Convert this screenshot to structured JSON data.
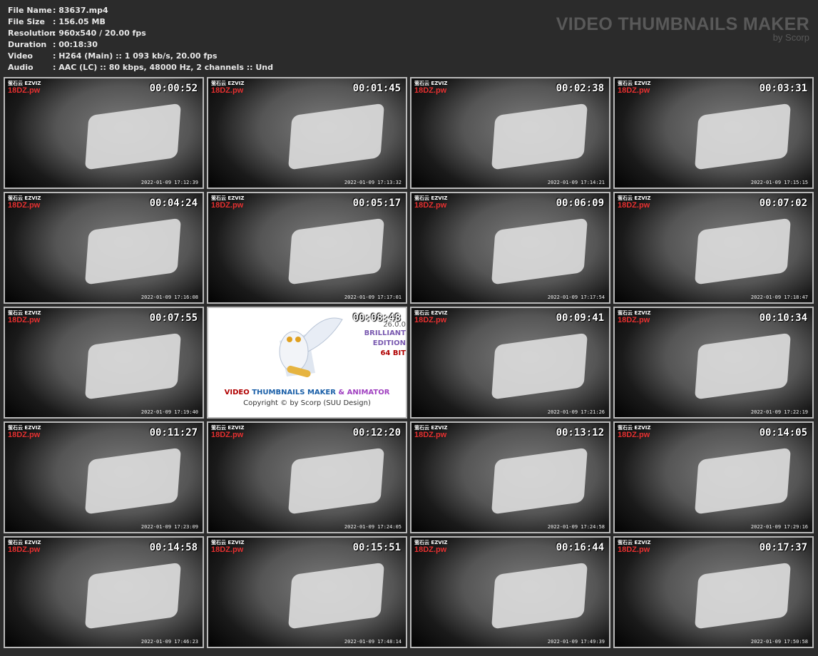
{
  "info": [
    {
      "label": "File Name",
      "value": ": 83637.mp4"
    },
    {
      "label": "File Size",
      "value": ": 156.05 MB"
    },
    {
      "label": "Resolution",
      "value": ": 960x540 / 20.00 fps"
    },
    {
      "label": "Duration",
      "value": ": 00:18:30"
    },
    {
      "label": "Video",
      "value": ": H264 (Main) :: 1 093 kb/s, 20.00 fps"
    },
    {
      "label": "Audio",
      "value": ": AAC (LC) :: 80 kbps, 48000 Hz, 2 channels :: Und"
    }
  ],
  "brand": {
    "title": "VIDEO THUMBNAILS MAKER",
    "subtitle": "by Scorp"
  },
  "watermark": {
    "logo": "萤石云 EZVIZ",
    "site": "18DZ.pw"
  },
  "thumbs": [
    {
      "time": "00:00:52",
      "stamp": "2022-01-09 17:12:39"
    },
    {
      "time": "00:01:45",
      "stamp": "2022-01-09 17:13:32"
    },
    {
      "time": "00:02:38",
      "stamp": "2022-01-09 17:14:21"
    },
    {
      "time": "00:03:31",
      "stamp": "2022-01-09 17:15:15"
    },
    {
      "time": "00:04:24",
      "stamp": "2022-01-09 17:16:08"
    },
    {
      "time": "00:05:17",
      "stamp": "2022-01-09 17:17:01"
    },
    {
      "time": "00:06:09",
      "stamp": "2022-01-09 17:17:54"
    },
    {
      "time": "00:07:02",
      "stamp": "2022-01-09 17:18:47"
    },
    {
      "time": "00:07:55",
      "stamp": "2022-01-09 17:19:40"
    },
    {
      "time": "00:08:48",
      "promo": true
    },
    {
      "time": "00:09:41",
      "stamp": "2022-01-09 17:21:26"
    },
    {
      "time": "00:10:34",
      "stamp": "2022-01-09 17:22:19"
    },
    {
      "time": "00:11:27",
      "stamp": "2022-01-09 17:23:09"
    },
    {
      "time": "00:12:20",
      "stamp": "2022-01-09 17:24:05"
    },
    {
      "time": "00:13:12",
      "stamp": "2022-01-09 17:24:58"
    },
    {
      "time": "00:14:05",
      "stamp": "2022-01-09 17:29:16"
    },
    {
      "time": "00:14:58",
      "stamp": "2022-01-09 17:46:23"
    },
    {
      "time": "00:15:51",
      "stamp": "2022-01-09 17:48:14"
    },
    {
      "time": "00:16:44",
      "stamp": "2022-01-09 17:49:39"
    },
    {
      "time": "00:17:37",
      "stamp": "2022-01-09 17:50:58"
    }
  ],
  "promo": {
    "version": "26.0.0",
    "edition1": "BRILLIANT",
    "edition2": "EDITION",
    "bits": "64 BIT",
    "title_video": "VIDEO",
    "title_thumbs": "THUMBNAILS MAKER",
    "title_amp": "& ANIMATOR",
    "copyright": "Copyright © by Scorp (SUU Design)",
    "colors": {
      "video": "#b00000",
      "thumbs": "#1a5fa8",
      "animator": "#a040c0"
    }
  }
}
